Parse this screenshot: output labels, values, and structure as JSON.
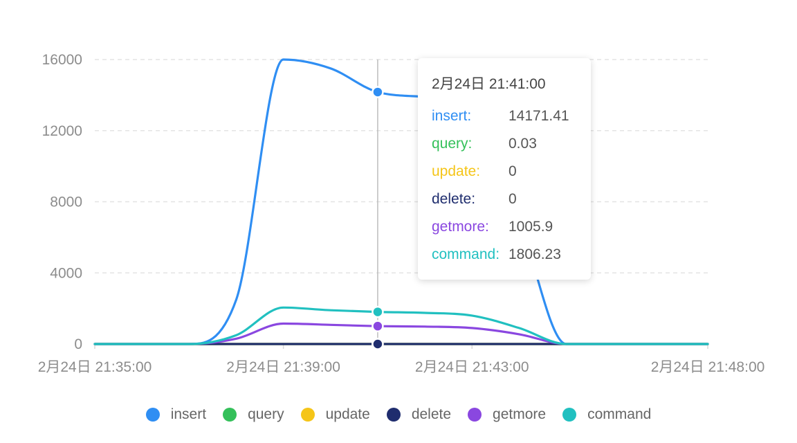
{
  "chart_data": {
    "type": "line",
    "title": "",
    "xlabel": "",
    "ylabel": "",
    "ylim": [
      0,
      16000
    ],
    "yticks": [
      0,
      4000,
      8000,
      12000,
      16000
    ],
    "xlim_minutes": [
      "21:35:00",
      "21:48:00"
    ],
    "xticks": [
      {
        "time": "21:35:00",
        "label": "2月24日 21:35:00"
      },
      {
        "time": "21:39:00",
        "label": "2月24日 21:39:00"
      },
      {
        "time": "21:43:00",
        "label": "2月24日 21:43:00"
      },
      {
        "time": "21:48:00",
        "label": "2月24日 21:48:00"
      }
    ],
    "x": [
      "21:35:00",
      "21:36:00",
      "21:37:00",
      "21:38:00",
      "21:39:00",
      "21:40:00",
      "21:41:00",
      "21:42:00",
      "21:43:00",
      "21:44:00",
      "21:45:00",
      "21:46:00",
      "21:47:00",
      "21:48:00"
    ],
    "series": [
      {
        "name": "insert",
        "color": "#2f8ef3",
        "values": [
          0,
          0,
          0,
          2500,
          16000,
          15500,
          14171.41,
          13900,
          13300,
          7000,
          0,
          0,
          0,
          0
        ]
      },
      {
        "name": "query",
        "color": "#34c05a",
        "values": [
          0,
          0,
          0,
          0,
          0,
          0,
          0.03,
          0,
          0,
          0,
          0,
          0,
          0,
          0
        ]
      },
      {
        "name": "update",
        "color": "#f5c518",
        "values": [
          0,
          0,
          0,
          0,
          0,
          0,
          0,
          0,
          0,
          0,
          0,
          0,
          0,
          0
        ]
      },
      {
        "name": "delete",
        "color": "#1f2d6e",
        "values": [
          0,
          0,
          0,
          0,
          0,
          0,
          0,
          0,
          0,
          0,
          0,
          0,
          0,
          0
        ]
      },
      {
        "name": "getmore",
        "color": "#8a47e0",
        "values": [
          0,
          0,
          0,
          300,
          1150,
          1080,
          1005.9,
          980,
          900,
          550,
          0,
          0,
          0,
          0
        ]
      },
      {
        "name": "command",
        "color": "#21c0c0",
        "values": [
          0,
          0,
          0,
          500,
          2050,
          1900,
          1806.23,
          1750,
          1600,
          900,
          0,
          0,
          0,
          0
        ]
      }
    ],
    "grid": true,
    "legend": "bottom",
    "highlight_time": "21:41:00"
  },
  "tooltip": {
    "title": "2月24日 21:41:00",
    "rows": [
      {
        "name": "insert:",
        "value": "14171.41",
        "color": "#2f8ef3"
      },
      {
        "name": "query:",
        "value": "0.03",
        "color": "#34c05a"
      },
      {
        "name": "update:",
        "value": "0",
        "color": "#f5c518"
      },
      {
        "name": "delete:",
        "value": "0",
        "color": "#1f2d6e"
      },
      {
        "name": "getmore:",
        "value": "1005.9",
        "color": "#8a47e0"
      },
      {
        "name": "command:",
        "value": "1806.23",
        "color": "#21c0c0"
      }
    ]
  },
  "legend": [
    {
      "name": "insert",
      "color": "#2f8ef3"
    },
    {
      "name": "query",
      "color": "#34c05a"
    },
    {
      "name": "update",
      "color": "#f5c518"
    },
    {
      "name": "delete",
      "color": "#1f2d6e"
    },
    {
      "name": "getmore",
      "color": "#8a47e0"
    },
    {
      "name": "command",
      "color": "#21c0c0"
    }
  ]
}
